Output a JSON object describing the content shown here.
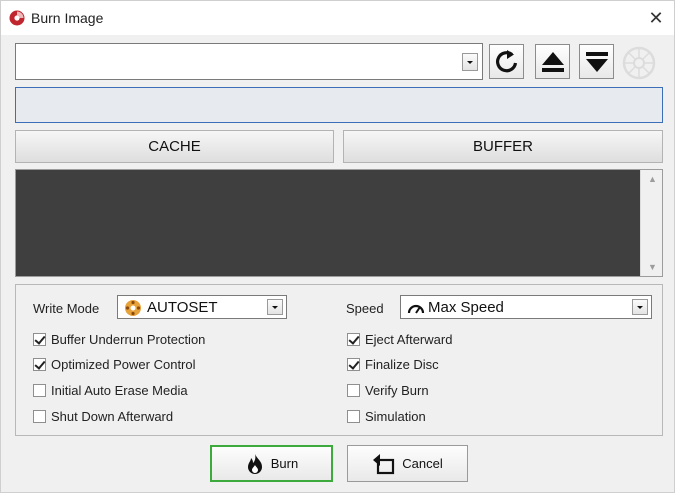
{
  "window": {
    "title": "Burn Image",
    "close_label": "✕"
  },
  "drive": {
    "selected": ""
  },
  "toolbar": {
    "refresh_icon": "refresh-icon",
    "eject_icon": "eject-icon",
    "load_icon": "load-tray-icon",
    "disc_icon": "disc-icon"
  },
  "status": {
    "text": ""
  },
  "cache_label": "CACHE",
  "buffer_label": "BUFFER",
  "log": {
    "text": ""
  },
  "options": {
    "write_mode_label": "Write Mode",
    "write_mode_value": "AUTOSET",
    "speed_label": "Speed",
    "speed_value": "Max Speed",
    "left": [
      {
        "label": "Buffer Underrun Protection",
        "checked": true
      },
      {
        "label": "Optimized Power Control",
        "checked": true
      },
      {
        "label": "Initial Auto Erase Media",
        "checked": false
      },
      {
        "label": "Shut Down Afterward",
        "checked": false
      }
    ],
    "right": [
      {
        "label": "Eject Afterward",
        "checked": true
      },
      {
        "label": "Finalize Disc",
        "checked": true
      },
      {
        "label": "Verify Burn",
        "checked": false
      },
      {
        "label": "Simulation",
        "checked": false
      }
    ]
  },
  "actions": {
    "burn_label": "Burn",
    "cancel_label": "Cancel"
  },
  "colors": {
    "accent_focus": "#3daa3d",
    "status_border": "#3c6fb8",
    "log_bg": "#3f3f3f"
  }
}
